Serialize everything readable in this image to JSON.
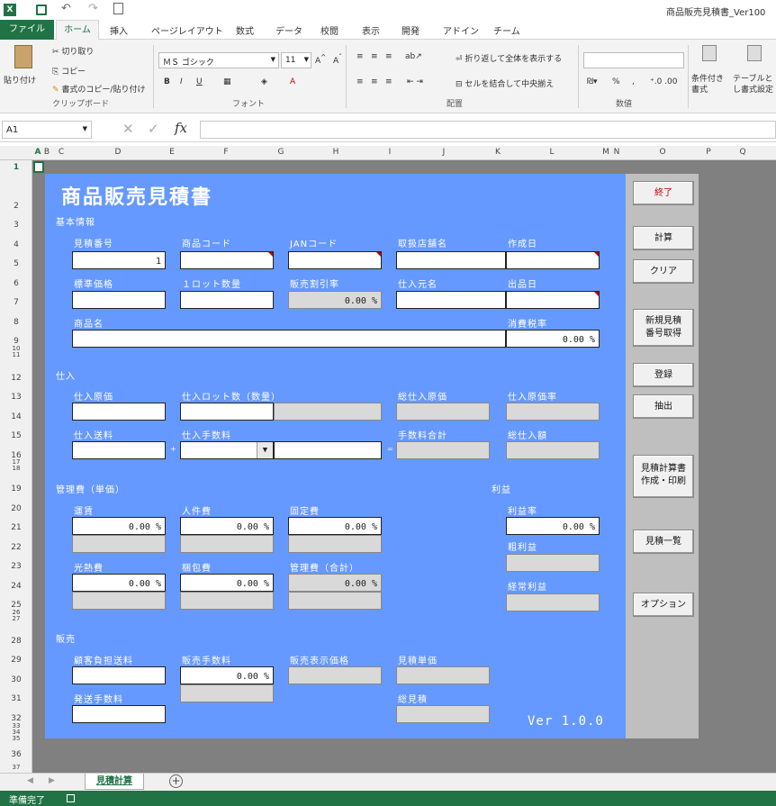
{
  "window": {
    "title": "商品販売見積書_Ver100"
  },
  "ribbon": {
    "tabs": [
      "ファイル",
      "ホーム",
      "挿入",
      "ページレイアウト",
      "数式",
      "データ",
      "校閲",
      "表示",
      "開発",
      "アドイン",
      "チーム"
    ],
    "clipboard": {
      "cut": "切り取り",
      "copy": "コピー",
      "format_painter": "書式のコピー/貼り付け",
      "paste": "貼り付け",
      "group": "クリップボード"
    },
    "font": {
      "name": "ＭＳ ゴシック",
      "size": "11",
      "group": "フォント"
    },
    "alignment": {
      "wrap": "折り返して全体を表示する",
      "merge": "セルを結合して中央揃え",
      "group": "配置"
    },
    "number": {
      "group": "数値"
    },
    "styles": {
      "conditional": "条件付き書式",
      "table": "テーブルとし書式設定"
    }
  },
  "formula_bar": {
    "cell_ref": "A1",
    "value": ""
  },
  "columns": [
    "A",
    "B",
    "C",
    "D",
    "E",
    "F",
    "G",
    "H",
    "I",
    "J",
    "K",
    "L",
    "M",
    "N",
    "O",
    "P",
    "Q"
  ],
  "rows": [
    "1",
    "2",
    "3",
    "4",
    "5",
    "6",
    "7",
    "8",
    "9",
    "10",
    "11",
    "12",
    "13",
    "14",
    "15",
    "16",
    "17",
    "18",
    "19",
    "20",
    "21",
    "22",
    "23",
    "24",
    "25",
    "26",
    "27",
    "28",
    "29",
    "30",
    "31",
    "32",
    "33",
    "34",
    "35",
    "36",
    "37"
  ],
  "form": {
    "title": "商品販売見積書",
    "sections": {
      "basic": "基本情報",
      "purchase": "仕入",
      "mgmt": "管理費（単価）",
      "profit": "利益",
      "sales": "販売"
    },
    "labels": {
      "estimate_no": "見積番号",
      "product_code": "商品コード",
      "jan_code": "JANコード",
      "store_name": "取扱店舗名",
      "created_date": "作成日",
      "std_price": "標準価格",
      "lot_qty": "１ロット数量",
      "discount_rate": "販売割引率",
      "supplier": "仕入元名",
      "ship_date": "出品日",
      "product_name": "商品名",
      "tax_rate": "消費税率",
      "cost_price": "仕入原価",
      "lot_count": "仕入ロット数（数量）",
      "total_cost": "総仕入原価",
      "cost_rate": "仕入原価率",
      "shipping_in": "仕入送料",
      "fee": "仕入手数料",
      "fee_total": "手数料合計",
      "total_purchase": "総仕入額",
      "freight": "運賃",
      "labor": "人件費",
      "fixed": "固定費",
      "utility": "光熱費",
      "packing": "梱包費",
      "mgmt_total": "管理費（合計）",
      "profit_rate": "利益率",
      "gross_profit": "粗利益",
      "ordinary_profit": "経常利益",
      "customer_shipping": "顧客負担送料",
      "sales_fee": "販売手数料",
      "display_price": "販売表示価格",
      "unit_price": "見積単価",
      "shipping_fee": "発送手数料",
      "total_estimate": "総見積"
    },
    "values": {
      "estimate_no": "1",
      "discount_rate": "0.00 %",
      "tax_rate": "0.00 %",
      "freight": "0.00 %",
      "labor": "0.00 %",
      "fixed": "0.00 %",
      "utility": "0.00 %",
      "packing": "0.00 %",
      "mgmt_total": "0.00 %",
      "profit_rate": "0.00 %",
      "sales_fee": "0.00 %"
    },
    "symbols": {
      "plus": "+",
      "equals": "="
    },
    "version": "Ver 1.0.0"
  },
  "buttons": {
    "exit": "終了",
    "calc": "計算",
    "clear": "クリア",
    "new_no_1": "新規見積",
    "new_no_2": "番号取得",
    "register": "登録",
    "extract": "抽出",
    "print_1": "見積計算書",
    "print_2": "作成・印刷",
    "list": "見積一覧",
    "option": "オプション"
  },
  "sheet": {
    "tab": "見積計算"
  },
  "status": {
    "text": "準備完了"
  },
  "colors": {
    "accent": "#217346",
    "panel": "#6699ff",
    "exit_text": "#c00000"
  }
}
